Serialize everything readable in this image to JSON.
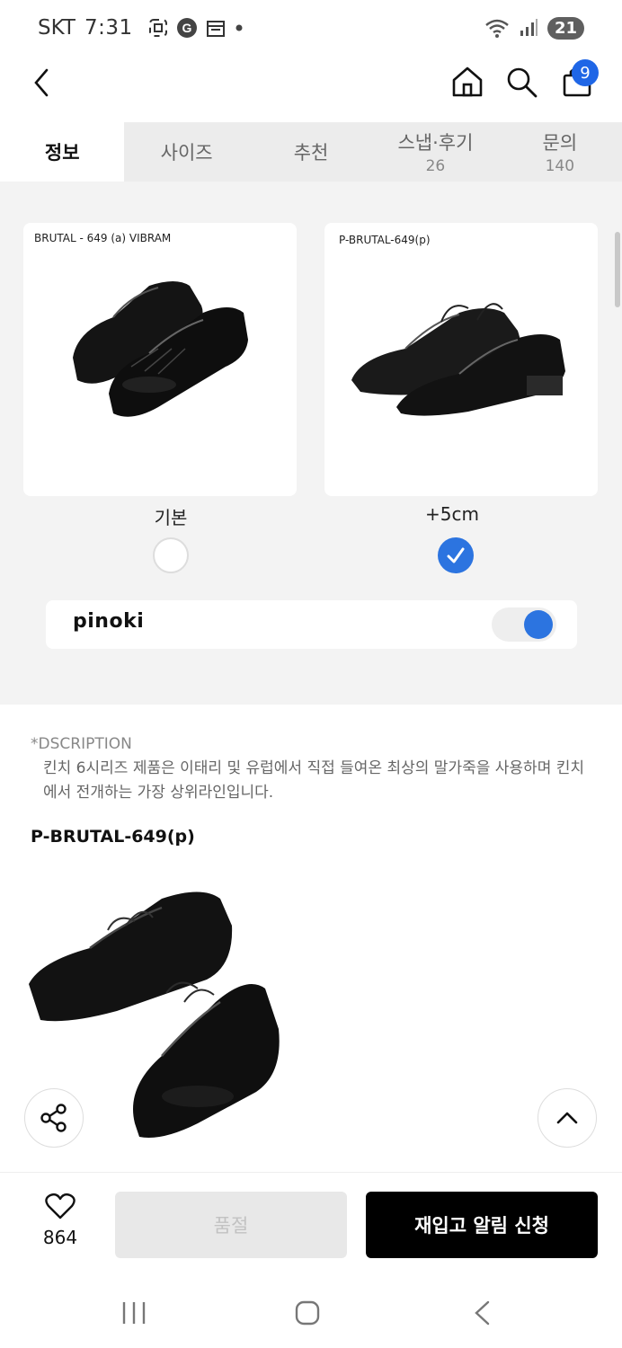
{
  "status_bar": {
    "carrier": "SKT",
    "time": "7:31",
    "battery": "21"
  },
  "header": {
    "cart_count": "9"
  },
  "tabs": [
    {
      "label": "정보",
      "count": ""
    },
    {
      "label": "사이즈",
      "count": ""
    },
    {
      "label": "추천",
      "count": ""
    },
    {
      "label": "스냅·후기",
      "count": "26"
    },
    {
      "label": "문의",
      "count": "140"
    }
  ],
  "options": [
    {
      "card_label": "BRUTAL - 649 (a) VIBRAM",
      "name": "기본",
      "selected": false
    },
    {
      "card_label": "P-BRUTAL-649(p)",
      "name": "+5cm",
      "selected": true
    }
  ],
  "pinoki": {
    "logo": "pinoki",
    "enabled": true
  },
  "description": {
    "title": "*DSCRIPTION",
    "body": "킨치 6시리즈 제품은 이태리 및 유럽에서 직접 들여온 최상의 말가죽을 사용하며 킨치에서 전개하는 가장 상위라인입니다."
  },
  "product_name": "P-BRUTAL-649(p)",
  "bottom": {
    "like_count": "864",
    "soldout_label": "품절",
    "notify_label": "재입고 알림 신청"
  },
  "colors": {
    "accent": "#2c74e0",
    "badge": "#1f66e6"
  }
}
